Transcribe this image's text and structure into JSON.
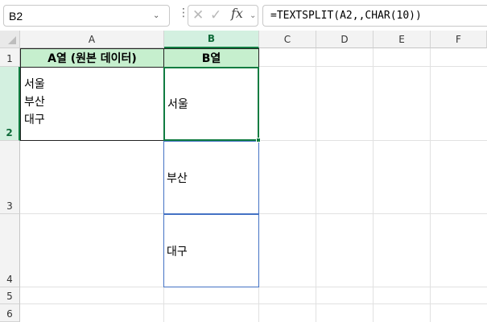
{
  "name_box": {
    "value": "B2"
  },
  "formula_bar": {
    "formula": "=TEXTSPLIT(A2,,CHAR(10))",
    "fx_label": "fx"
  },
  "columns": [
    "A",
    "B",
    "C",
    "D",
    "E",
    "F"
  ],
  "rows": [
    "1",
    "2",
    "3",
    "4",
    "5",
    "6"
  ],
  "cells": {
    "A1": "A열 (원본 데이터)",
    "B1": "B열",
    "A2_lines": [
      "서울",
      "부산",
      "대구"
    ],
    "B2": "서울",
    "B3": "부산",
    "B4": "대구"
  },
  "colors": {
    "header_fill": "#c6efce",
    "selection": "#107c41",
    "spill_border": "#4472c4"
  },
  "icons": [
    "chevron-down-icon",
    "more-options-icon",
    "cancel-icon",
    "enter-icon",
    "fx-icon",
    "select-all-icon"
  ]
}
